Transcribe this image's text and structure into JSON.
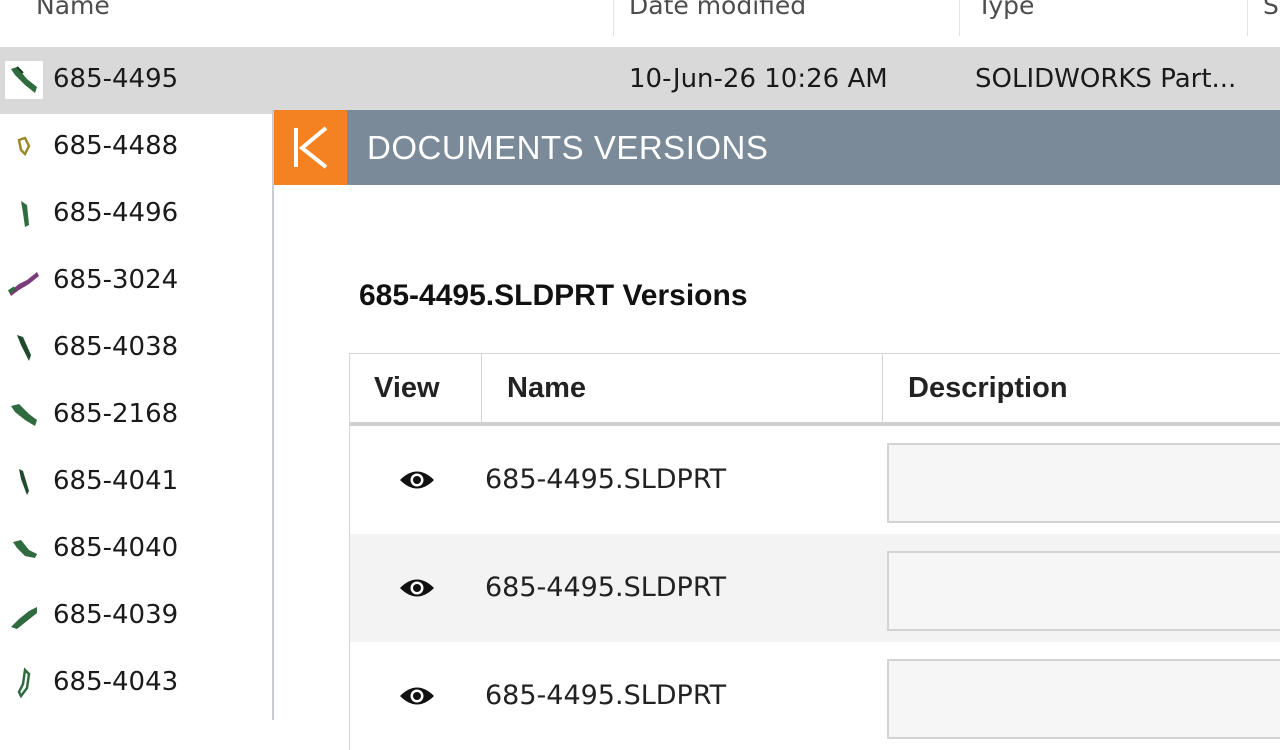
{
  "columns": {
    "name": "Name",
    "date_modified": "Date modified",
    "type": "Type",
    "size_partial": "S"
  },
  "files": [
    {
      "name": "685-4495",
      "date": "10-Jun-26 10:26 AM",
      "type": "SOLIDWORKS Part...",
      "selected": true
    },
    {
      "name": "685-4488",
      "date": "",
      "type": ""
    },
    {
      "name": "685-4496",
      "date": "",
      "type": ""
    },
    {
      "name": "685-3024",
      "date": "",
      "type": ""
    },
    {
      "name": "685-4038",
      "date": "",
      "type": ""
    },
    {
      "name": "685-2168",
      "date": "",
      "type": ""
    },
    {
      "name": "685-4041",
      "date": "",
      "type": ""
    },
    {
      "name": "685-4040",
      "date": "",
      "type": ""
    },
    {
      "name": "685-4039",
      "date": "",
      "type": ""
    },
    {
      "name": "685-4043",
      "date": "",
      "type": ""
    }
  ],
  "dialog": {
    "title": "DOCUMENTS VERSIONS",
    "logo_letter": "K",
    "versions_heading": "685-4495.SLDPRT Versions",
    "table": {
      "headers": {
        "view": "View",
        "name": "Name",
        "description": "Description"
      },
      "rows": [
        {
          "name": "685-4495.SLDPRT",
          "description": ""
        },
        {
          "name": "685-4495.SLDPRT",
          "description": ""
        },
        {
          "name": "685-4495.SLDPRT",
          "description": ""
        }
      ]
    }
  },
  "colors": {
    "titlebar": "#7a8a99",
    "logo_accent": "#f58220",
    "selected_row": "#d9d9d9"
  },
  "icons": {
    "file": "solidworks-part-icon",
    "view": "eye-icon"
  }
}
